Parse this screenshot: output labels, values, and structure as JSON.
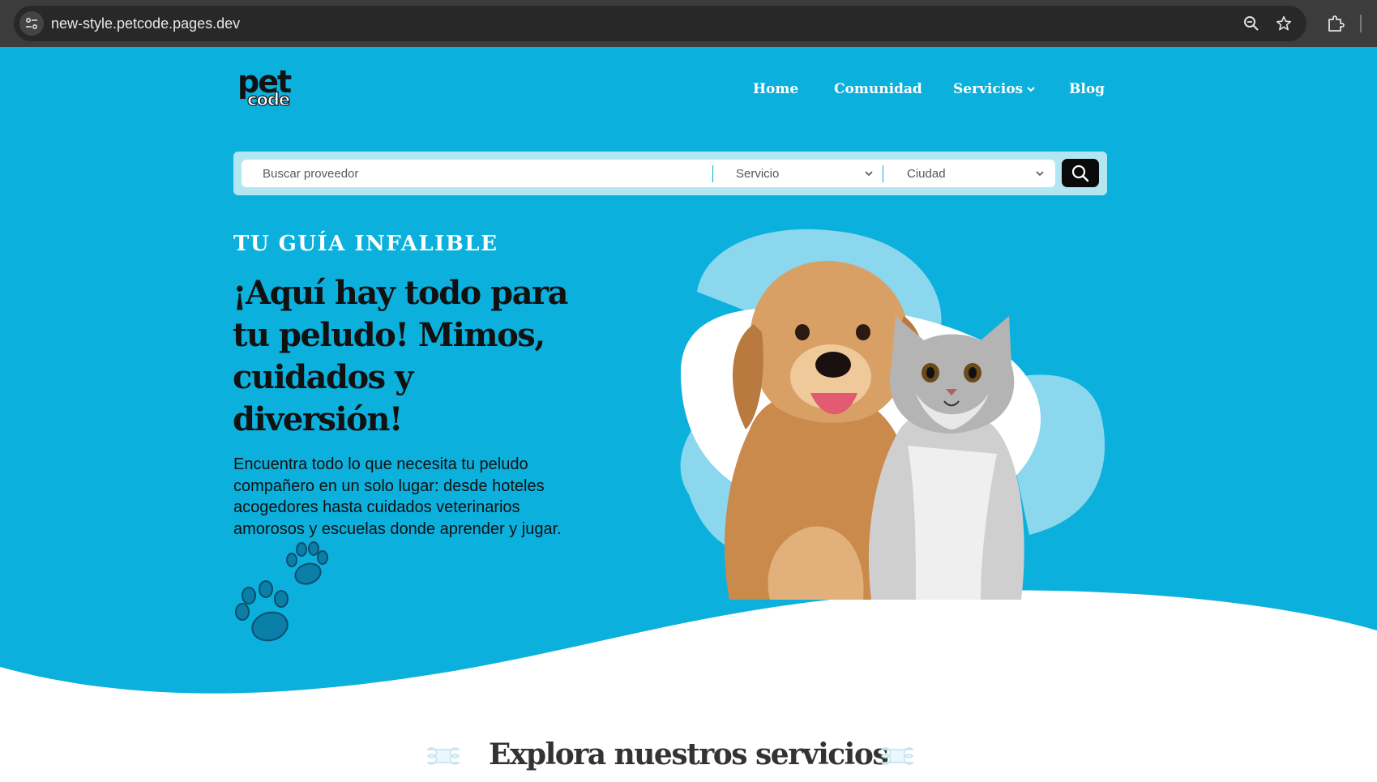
{
  "browser": {
    "url": "new-style.petcode.pages.dev",
    "icons": [
      "site-info-icon",
      "zoom-icon",
      "bookmark-star-icon",
      "extensions-icon"
    ]
  },
  "header": {
    "logo": {
      "line1": "pet",
      "line2": "code"
    },
    "nav": [
      {
        "label": "Home"
      },
      {
        "label": "Comunidad"
      },
      {
        "label": "Servicios",
        "has_dropdown": true
      },
      {
        "label": "Blog"
      }
    ]
  },
  "search": {
    "placeholder": "Buscar proveedor",
    "service_select": "Servicio",
    "city_select": "Ciudad",
    "button_icon": "search-icon"
  },
  "hero": {
    "eyebrow": "TU GUÍA INFALIBLE",
    "headline": "¡Aquí hay todo para tu peludo! Mimos, cuidados y diversión!",
    "description": "Encuentra todo lo que necesita tu peludo compañero en un solo lugar: desde hoteles acogedores hasta cuidados veterinarios amorosos y escuelas donde aprender y jugar."
  },
  "services": {
    "title": "Explora nuestros servicios"
  },
  "colors": {
    "hero_bg": "#0cb0dc",
    "blob_light": "#8ad7ee",
    "search_wrap": "#b3e6f3",
    "text_dark": "#111111",
    "chrome_bg": "#3c3c3c"
  }
}
